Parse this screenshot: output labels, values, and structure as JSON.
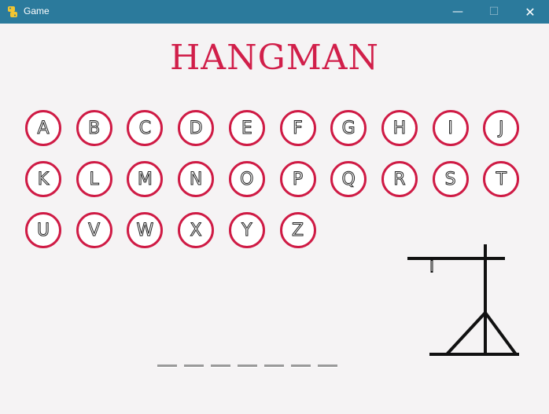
{
  "window": {
    "title": "Game",
    "controls": {
      "minimize": "—",
      "maximize": "☐",
      "close": "✕"
    }
  },
  "game": {
    "title": "HANGMAN",
    "letters": [
      "A",
      "B",
      "C",
      "D",
      "E",
      "F",
      "G",
      "H",
      "I",
      "J",
      "K",
      "L",
      "M",
      "N",
      "O",
      "P",
      "Q",
      "R",
      "S",
      "T",
      "U",
      "V",
      "W",
      "X",
      "Y",
      "Z"
    ],
    "word_blank_count": 7,
    "accent_color": "#d11f4a",
    "gallows_icon": "gallows-icon"
  }
}
